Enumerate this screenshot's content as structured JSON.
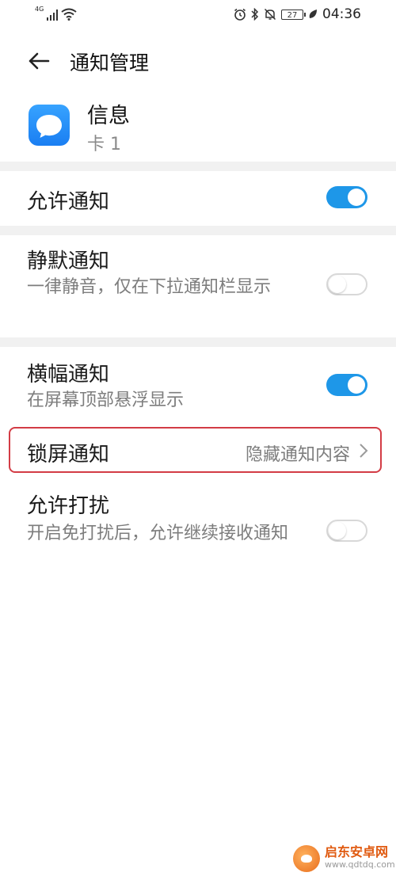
{
  "status_bar": {
    "network": "4G",
    "battery": "27",
    "time": "04:36",
    "icons": [
      "signal-icon",
      "wifi-icon",
      "alarm-icon",
      "bluetooth-icon",
      "mute-icon",
      "battery-icon",
      "leaf-icon"
    ]
  },
  "header": {
    "title": "通知管理"
  },
  "app": {
    "name": "信息",
    "sub": "卡 1",
    "icon": "message-bubble-icon",
    "icon_color": "#2a8ff7"
  },
  "settings": {
    "allow_notify": {
      "title": "允许通知",
      "enabled": true
    },
    "silent_notify": {
      "title": "静默通知",
      "desc": "一律静音，仅在下拉通知栏显示",
      "enabled": false
    },
    "banner_notify": {
      "title": "横幅通知",
      "desc": "在屏幕顶部悬浮显示",
      "enabled": true
    },
    "lock_screen": {
      "title": "锁屏通知",
      "value": "隐藏通知内容"
    },
    "allow_dnd": {
      "title": "允许打扰",
      "desc": "开启免打扰后，允许继续接收通知",
      "enabled": false
    }
  },
  "colors": {
    "toggle_on": "#1e97e8",
    "highlight": "#d33c45"
  },
  "watermark": {
    "title": "启东安卓网",
    "url": "www.qdtdq.com"
  }
}
